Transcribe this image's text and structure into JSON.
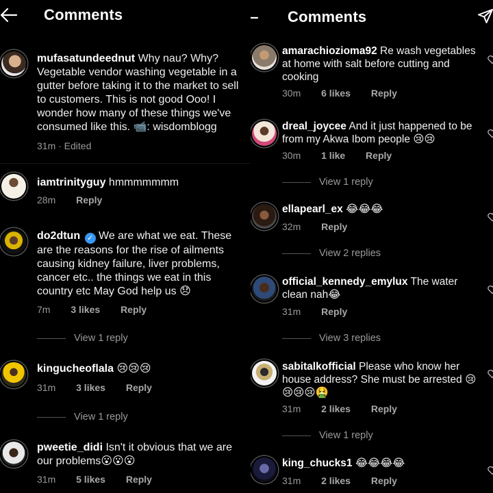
{
  "left": {
    "title": "Comments",
    "comments": [
      {
        "username": "mufasatundeednut",
        "text": "Why nau? Why? Vegetable vendor washing vegetable in a gutter before taking it to the market to sell to customers. This is not good Ooo! I wonder how many of these things we've consumed like this. 📹: wisdomblogg",
        "time": "31m",
        "edited": "· Edited"
      },
      {
        "username": "iamtrinityguy",
        "text": "hmmmmmmm",
        "time": "28m",
        "reply": "Reply"
      },
      {
        "username": "do2dtun",
        "verified_mark": "✓",
        "text": "We are what we eat. These are the reasons for the rise of ailments causing kidney failure, liver problems, cancer etc.. the things we eat in this country etc May God help us 😞",
        "time": "7m",
        "likes": "3 likes",
        "reply": "Reply",
        "view_replies": "View 1 reply"
      },
      {
        "username": "kingucheoflala",
        "text": "😢😢😢",
        "time": "31m",
        "likes": "3 likes",
        "reply": "Reply",
        "view_replies": "View 1 reply"
      },
      {
        "username": "pweetie_didi",
        "text": "Isn't it obvious that we are our problems😮😮😮",
        "time": "31m",
        "likes": "5 likes",
        "reply": "Reply"
      }
    ]
  },
  "right": {
    "title": "Comments",
    "comments": [
      {
        "username": "amarachiozioma92",
        "text": "Re wash vegetables at home with salt before cutting and cooking",
        "time": "30m",
        "likes": "6 likes",
        "reply": "Reply"
      },
      {
        "username": "dreal_joycee",
        "text": "And it just happened to be from my Akwa Ibom people 😢😢",
        "time": "30m",
        "likes": "1 like",
        "reply": "Reply",
        "view_replies": "View 1 reply"
      },
      {
        "username": "ellapearl_ex",
        "text": "😂😂😂",
        "time": "32m",
        "reply": "Reply",
        "view_replies": "View 2 replies"
      },
      {
        "username": "official_kennedy_emylux",
        "text": "The water clean nah😂",
        "time": "31m",
        "reply": "Reply",
        "view_replies": "View 3 replies"
      },
      {
        "username": "sabitalkofficial",
        "text": "Please who know her house address? She must be arrested 😢😢😢😢🤮",
        "time": "31m",
        "likes": "2 likes",
        "reply": "Reply",
        "view_replies": "View 1 reply"
      },
      {
        "username": "king_chucks1",
        "text": "😂😂😂😂",
        "time": "31m",
        "likes": "2 likes",
        "reply": "Reply"
      }
    ]
  },
  "icons": {
    "back": "arrow-left-icon",
    "send": "paper-plane-icon",
    "like": "heart-outline-icon",
    "verified": "verified-badge-icon"
  },
  "colors": {
    "background": "#000000",
    "text": "#ffffff",
    "muted": "#9a9a9a",
    "verified": "#3897f0"
  }
}
